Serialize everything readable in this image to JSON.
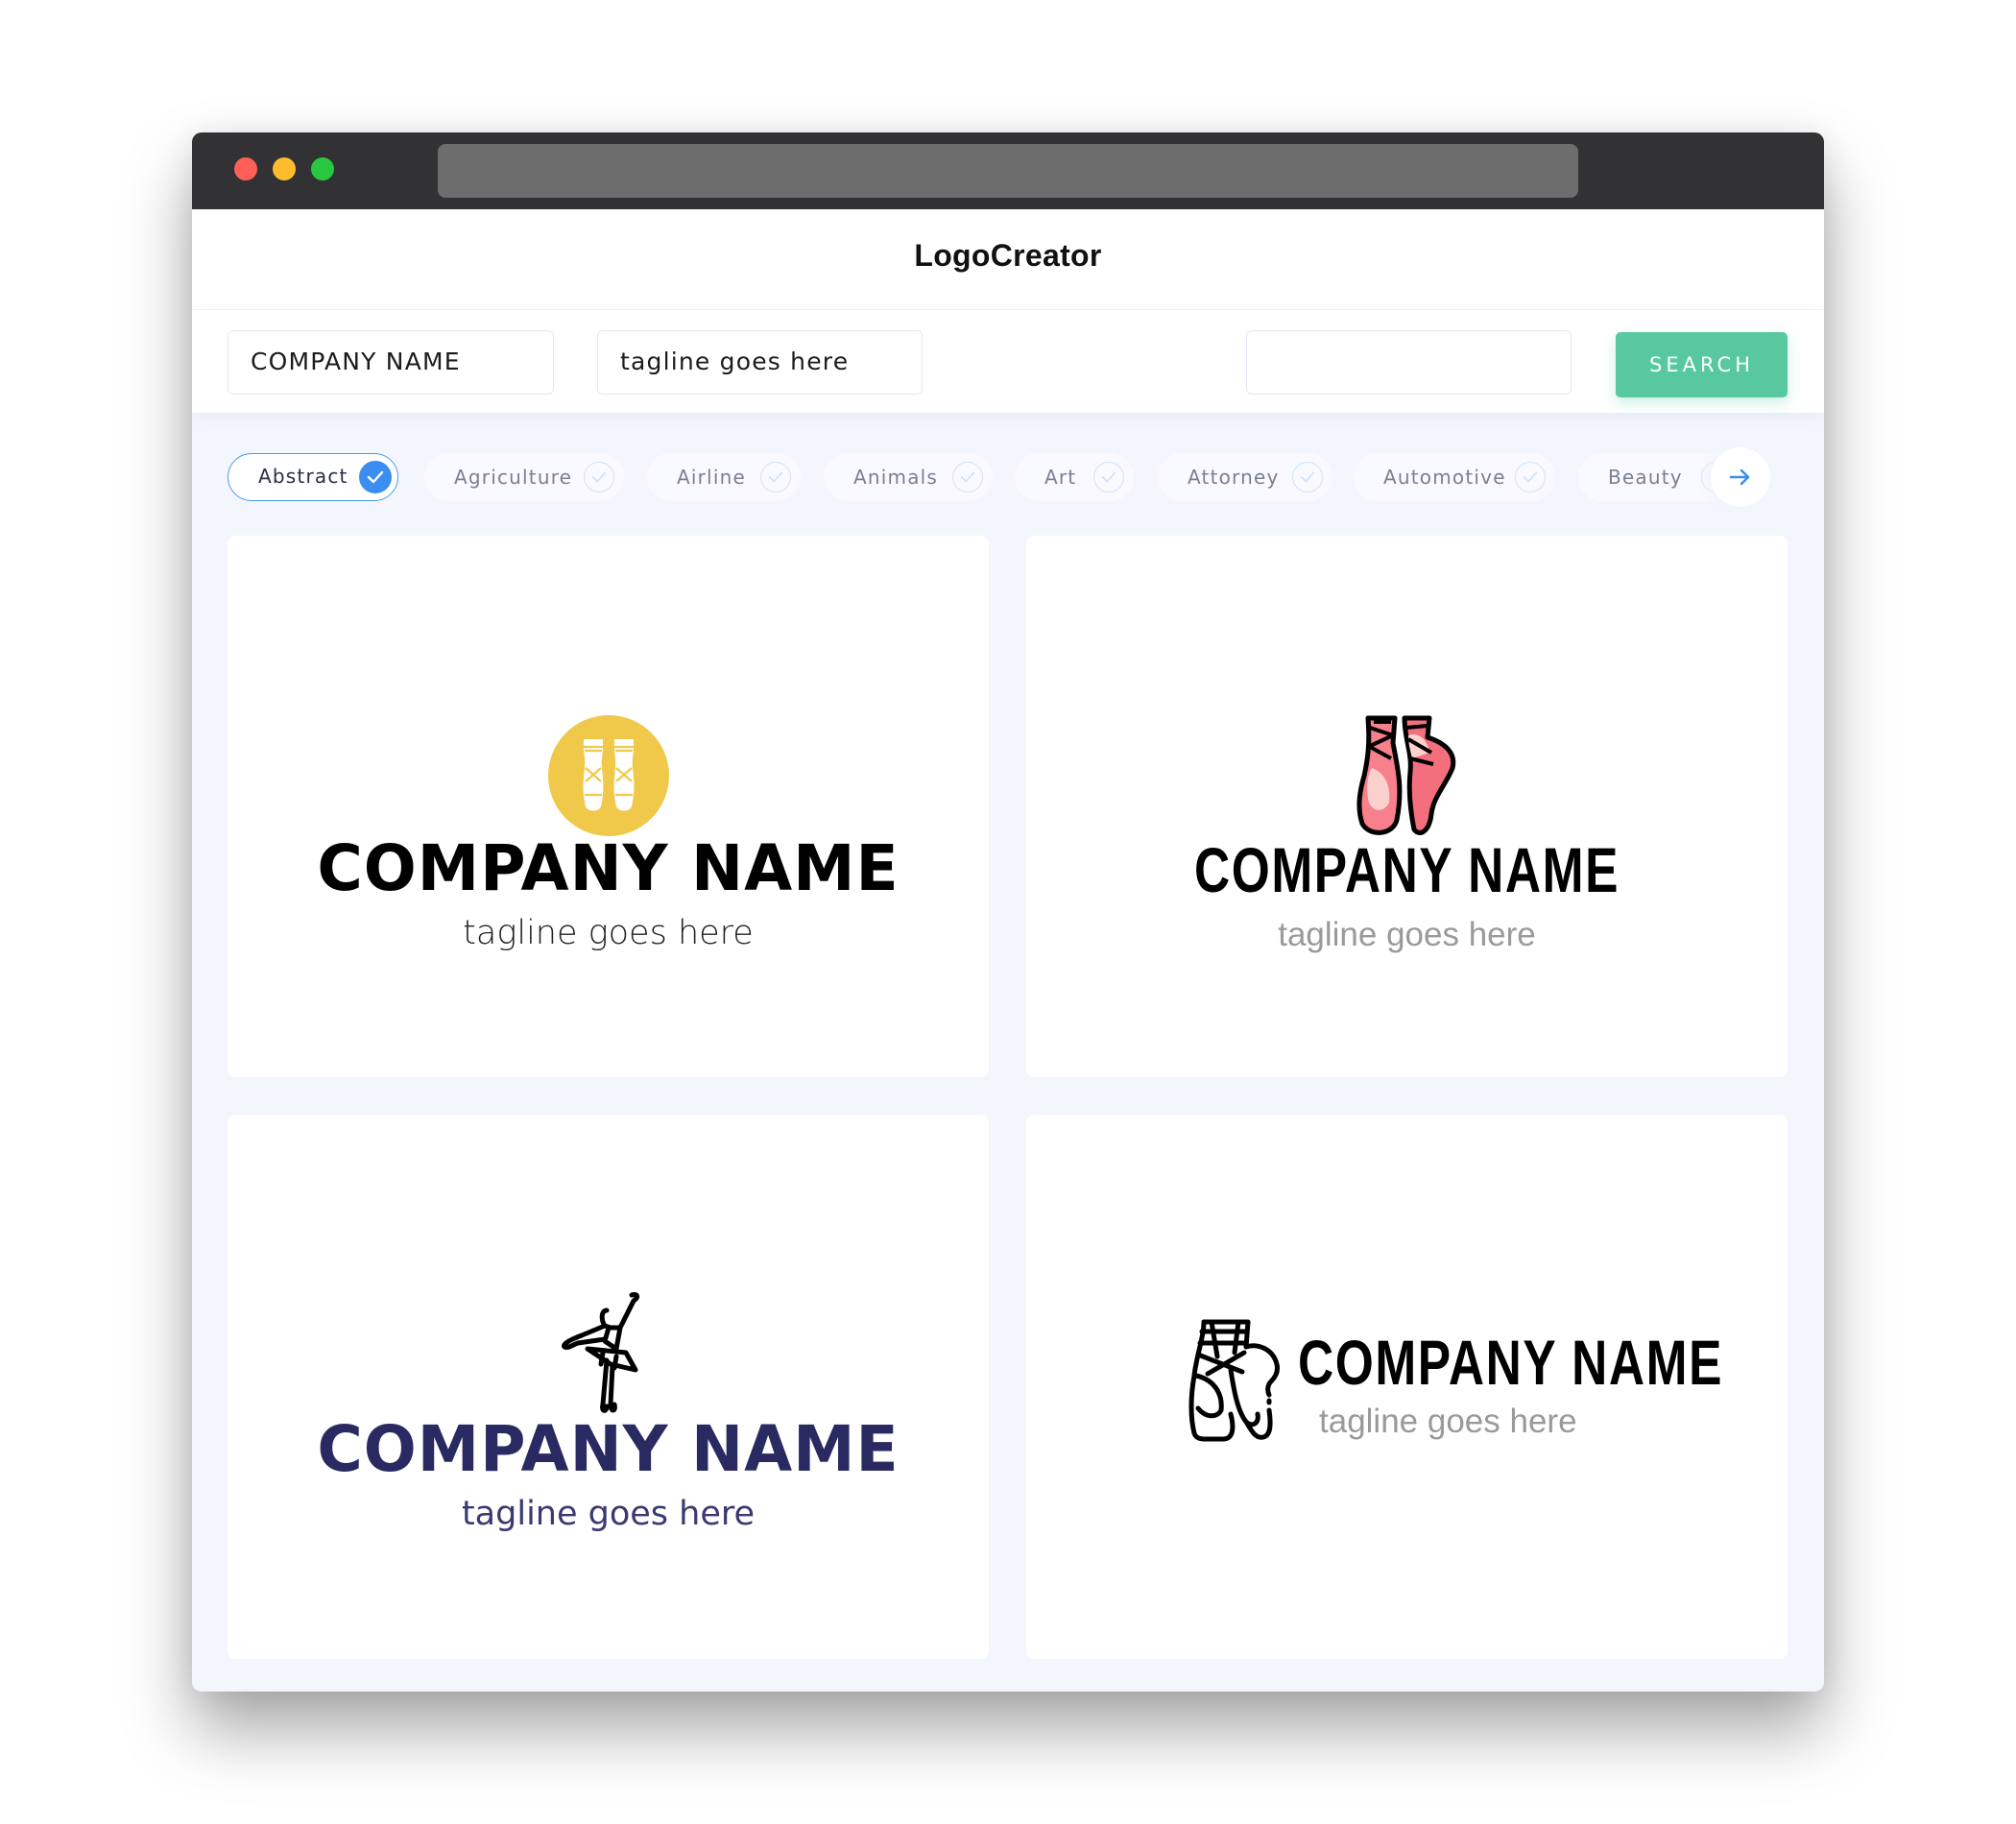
{
  "app": {
    "title": "LogoCreator"
  },
  "window": {
    "traffic_lights": [
      "close",
      "minimize",
      "maximize"
    ]
  },
  "search": {
    "company_name_value": "COMPANY NAME",
    "tagline_value": "tagline goes here",
    "keyword_value": "",
    "button_label": "SEARCH",
    "accent_color": "#58c99f"
  },
  "categories": {
    "items": [
      {
        "label": "Abstract",
        "selected": true
      },
      {
        "label": "Agriculture",
        "selected": false
      },
      {
        "label": "Airline",
        "selected": false
      },
      {
        "label": "Animals",
        "selected": false
      },
      {
        "label": "Art",
        "selected": false
      },
      {
        "label": "Attorney",
        "selected": false
      },
      {
        "label": "Automotive",
        "selected": false
      },
      {
        "label": "Beauty",
        "selected": false
      }
    ],
    "next_icon": "arrow-right-icon",
    "selected_color": "#3b8ef0"
  },
  "logos": [
    {
      "icon": "ballet-shoes-circle-icon",
      "company": "COMPANY NAME",
      "tagline": "tagline goes here",
      "icon_color": "#f0c94b",
      "text_color": "#000000"
    },
    {
      "icon": "pink-pointe-shoes-icon",
      "company": "COMPANY NAME",
      "tagline": "tagline goes here",
      "icon_color": "#f36f7d",
      "text_color": "#000000"
    },
    {
      "icon": "ballerina-icon",
      "company": "COMPANY NAME",
      "tagline": "tagline goes here",
      "icon_color": "#000000",
      "text_color": "#2a2a63"
    },
    {
      "icon": "pointe-shoes-outline-icon",
      "company": "COMPANY NAME",
      "tagline": "tagline goes here",
      "icon_color": "#000000",
      "text_color": "#000000"
    }
  ]
}
